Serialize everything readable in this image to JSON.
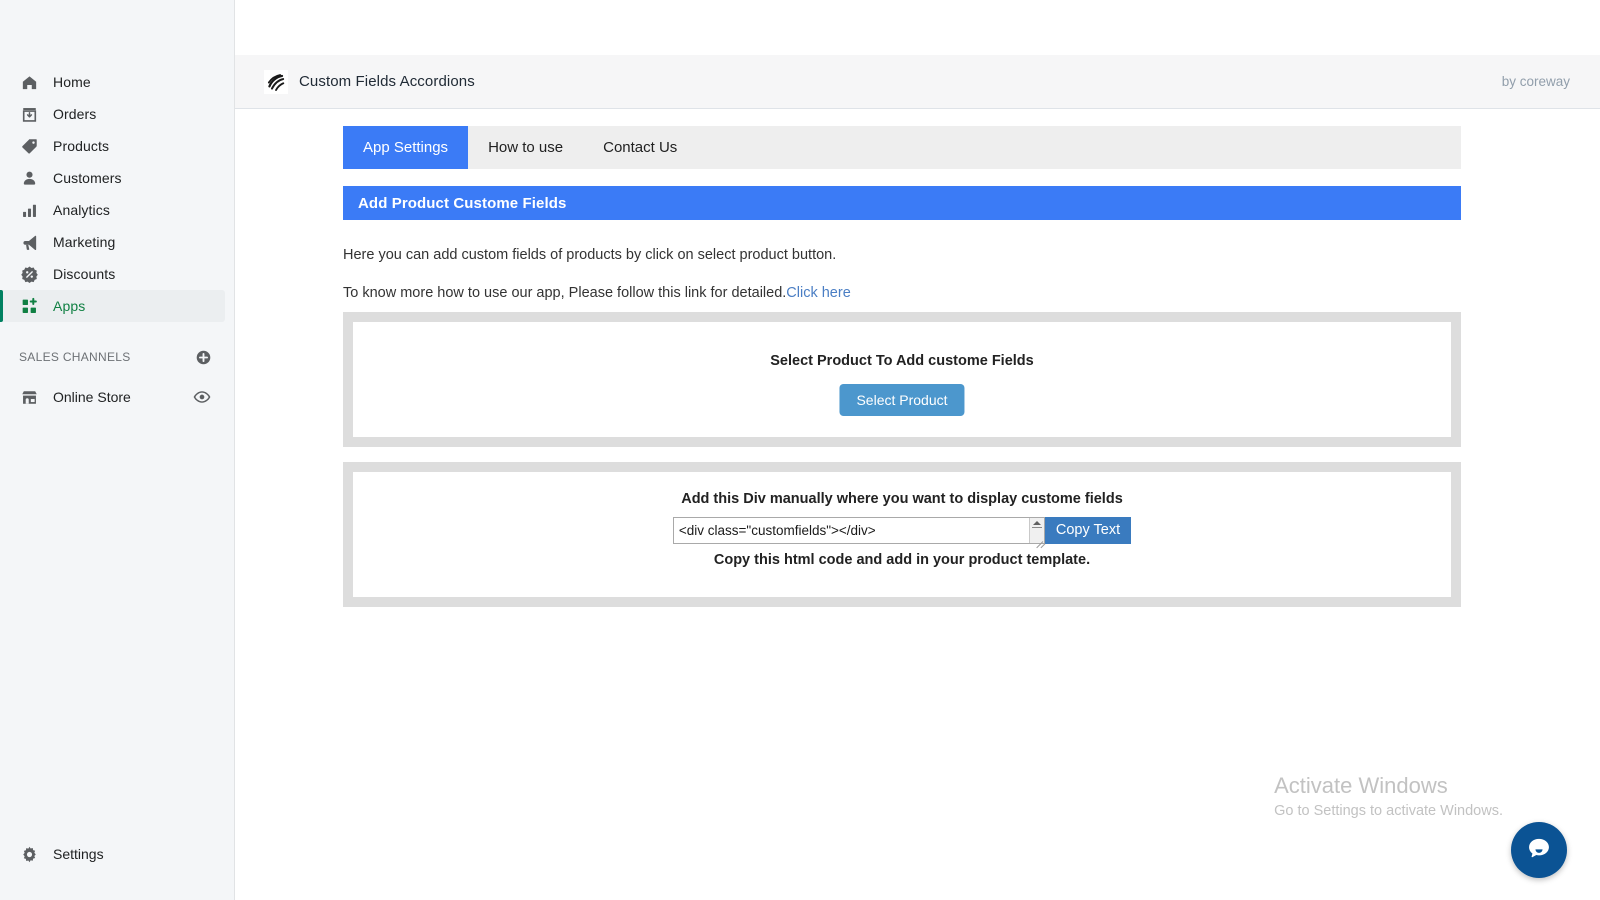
{
  "sidebar": {
    "items": [
      {
        "label": "Home",
        "icon": "home-icon",
        "active": false
      },
      {
        "label": "Orders",
        "icon": "orders-icon",
        "active": false
      },
      {
        "label": "Products",
        "icon": "products-tag-icon",
        "active": false
      },
      {
        "label": "Customers",
        "icon": "customers-person-icon",
        "active": false
      },
      {
        "label": "Analytics",
        "icon": "analytics-bars-icon",
        "active": false
      },
      {
        "label": "Marketing",
        "icon": "marketing-megaphone-icon",
        "active": false
      },
      {
        "label": "Discounts",
        "icon": "discounts-percent-icon",
        "active": false
      },
      {
        "label": "Apps",
        "icon": "apps-grid-plus-icon",
        "active": true
      }
    ],
    "channels_header": "SALES CHANNELS",
    "channels_add_icon": "plus-circle-icon",
    "channels": [
      {
        "label": "Online Store",
        "icon": "storefront-icon",
        "action_icon": "eye-icon"
      }
    ],
    "settings": {
      "label": "Settings",
      "icon": "gear-icon"
    },
    "accent_color": "#008060",
    "active_text_color": "#108043"
  },
  "app_header": {
    "logo_icon": "app-swirl-logo-icon",
    "title": "Custom Fields Accordions",
    "byline": "by coreway"
  },
  "tabs": [
    {
      "label": "App Settings",
      "active": true
    },
    {
      "label": "How to use",
      "active": false
    },
    {
      "label": "Contact Us",
      "active": false
    }
  ],
  "section": {
    "heading": "Add Product Custome Fields",
    "heading_color": "#3b7bf6"
  },
  "intro": {
    "line1": "Here you can add custom fields of products by click on select product button.",
    "line2_text": "To know more how to use our app, Please follow this link for detailed.",
    "line2_link": "Click here",
    "link_color": "#4a7ec4"
  },
  "select_panel": {
    "title": "Select Product To Add custome Fields",
    "button_label": "Select Product",
    "button_color": "#4c97cd"
  },
  "code_panel": {
    "title": "Add this Div manually where you want to display custome fields",
    "code_value": "<div class=\"customfields\"></div>",
    "code_placeholder": "",
    "copy_button_label": "Copy Text",
    "copy_button_color": "#3a7bbf",
    "note": "Copy this html code and add in your product template.",
    "scrollbar_icon": "scroll-up-arrow-icon",
    "resize_icon": "resize-grip-icon"
  },
  "watermark": {
    "title": "Activate Windows",
    "subtitle": "Go to Settings to activate Windows."
  },
  "chat": {
    "icon": "chat-bubble-icon",
    "color": "#0b5394"
  }
}
